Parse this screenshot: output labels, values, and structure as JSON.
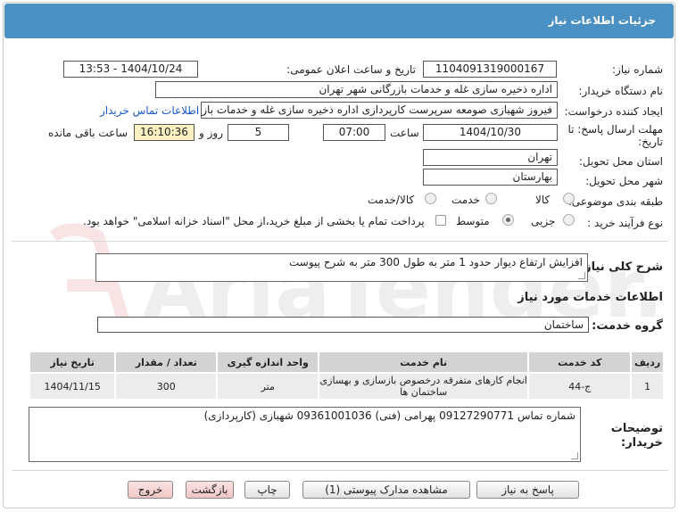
{
  "header": {
    "title": "جزئیات اطلاعات نیاز"
  },
  "form": {
    "need_number_label": "شماره نیاز:",
    "need_number": "1104091319000167",
    "announce_label": "تاریخ و ساعت اعلان عمومی:",
    "announce_value": "1404/10/24 - 13:53",
    "buyer_org_label": "نام دستگاه خریدار:",
    "buyer_org": "اداره ذخیره سازی غله و خدمات بازرگانی شهر تهران",
    "creator_label": "ایجاد کننده درخواست:",
    "creator": "فیروز شهبازی صومعه سرپرست کارپردازی  اداره ذخیره سازی غله و خدمات بازرگا",
    "contact_link": "اطلاعات تماس خریدار",
    "deadline_label_1": "مهلت ارسال پاسخ: تا",
    "deadline_label_2": "تاریخ:",
    "deadline_date": "1404/10/30",
    "time_label": "ساعت",
    "deadline_time": "07:00",
    "days_value": "5",
    "days_label": "روز و",
    "remaining_time": "16:10:36",
    "remaining_label": "ساعت باقی مانده",
    "province_label": "استان محل تحویل:",
    "province": "تهران",
    "city_label": "شهر محل تحویل:",
    "city": "بهارستان",
    "category_label": "طبقه بندی موضوعی:",
    "category_options": [
      "کالا",
      "خدمت",
      "کالا/خدمت"
    ],
    "purchase_type_label": "نوع فرآیند خرید :",
    "purchase_options": [
      "جزیی",
      "متوسط"
    ],
    "payment_note": "پرداخت تمام یا بخشی از مبلغ خرید،از محل \"اسناد خزانه اسلامی\" خواهد بود."
  },
  "description": {
    "label": "شرح کلی نیاز:",
    "value": "افزایش ارتفاع دیوار حدود 1 متر به طول 300 متر به شرح پیوست"
  },
  "services": {
    "section_title": "اطلاعات خدمات مورد نیاز",
    "group_label": "گروه خدمت:",
    "group_value": "ساختمان",
    "table": {
      "headers": [
        "ردیف",
        "کد خدمت",
        "نام خدمت",
        "واحد اندازه گیری",
        "تعداد / مقدار",
        "تاریخ نیاز"
      ],
      "rows": [
        [
          "1",
          "ج-44",
          "انجام کارهای متفرقه درخصوص بازسازی و بهسازی ساختمان ها",
          "متر",
          "300",
          "1404/11/15"
        ]
      ]
    }
  },
  "buyer_notes": {
    "label_1": "توضیحات",
    "label_2": "خریدار:",
    "value": "شماره تماس 09127290771 پهرامی (فنی) 09361001036 شهبازی  (کارپردازی)"
  },
  "buttons": {
    "reply": "پاسخ به نیاز",
    "docs": "مشاهده مدارک پیوستی (1)",
    "print": "چاپ",
    "back": "بازگشت",
    "exit": "خروج"
  },
  "watermark": {
    "text": "AriaTender.net"
  },
  "colors": {
    "title_bar": "#4a90c2",
    "link": "#1a56c8",
    "highlight": "#fbf0c2"
  }
}
